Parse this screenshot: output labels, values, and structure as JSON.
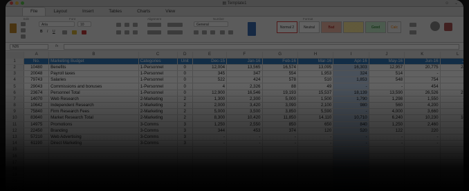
{
  "window": {
    "title": "Template1",
    "right_controls": [
      "☺",
      "⌄"
    ]
  },
  "ribbon": {
    "tabs": [
      "File",
      "Layout",
      "Insert",
      "Tables",
      "Charts",
      "View"
    ],
    "active_tab": "File",
    "font_name": "Aria",
    "font_size": "10",
    "number_format": "General",
    "group_labels": [
      "Edit",
      "Font",
      "Alignment",
      "Number",
      "Format"
    ],
    "styles": [
      "Normal 2",
      "Neutral",
      "Bad",
      "Good",
      "Calc"
    ],
    "colors": {
      "header_blue": "#2f77b8",
      "selected": "#bfd5ef",
      "normal_border": "#d23a3a"
    }
  },
  "formula_bar": {
    "name_box": "N26",
    "fx": "fx",
    "value": ""
  },
  "grid": {
    "columns": [
      "A",
      "B",
      "C",
      "D",
      "E",
      "F",
      "G",
      "H",
      "I",
      "J",
      "K",
      "L"
    ],
    "rows": [
      {
        "n": "1",
        "cells": [
          "No.",
          "Marketing Budget",
          "Categories",
          "Unit",
          "Dec-15",
          "Jan-16",
          "Feb-16",
          "Mar-16",
          "Apr-16",
          "May-16",
          "Jun-16",
          "Jul-16"
        ]
      },
      {
        "n": "2",
        "cells": [
          "10480",
          "Benefits",
          "1-Personnel",
          "0",
          "12,004",
          "13,565",
          "16,574",
          "13,095",
          "16,303",
          "12,957",
          "20,775",
          "24,766"
        ]
      },
      {
        "n": "3",
        "cells": [
          "20048",
          "Payroll taxes",
          "1-Personnel",
          "0",
          "345",
          "347",
          "554",
          "1,953",
          "324",
          "514",
          "-",
          "-"
        ]
      },
      {
        "n": "4",
        "cells": [
          "79743",
          "Salaries",
          "1-Personnel",
          "0",
          "522",
          "424",
          "578",
          "510",
          "1,853",
          "548",
          "754",
          "533"
        ]
      },
      {
        "n": "5",
        "cells": [
          "29043",
          "Commissions and bonuses",
          "1-Personnel",
          "0",
          "4",
          "2,326",
          "88",
          "49",
          "-",
          "-",
          "454",
          "226"
        ]
      },
      {
        "n": "6",
        "cells": [
          "23674",
          "Personnel Total",
          "1-Personnel",
          "0",
          "12,900",
          "16,546",
          "19,193",
          "15,537",
          "18,139",
          "13,590",
          "26,526",
          "25,599"
        ]
      },
      {
        "n": "7",
        "cells": [
          "14070",
          "Web Research",
          "2-Marketing",
          "2",
          "1,300",
          "2,300",
          "5,000",
          "1,500",
          "1,790",
          "1,298",
          "1,550",
          "4,000"
        ]
      },
      {
        "n": "8",
        "cells": [
          "10642",
          "Independent Research",
          "2-Marketing",
          "2",
          "2,000",
          "3,420",
          "3,090",
          "2,100",
          "980",
          "560",
          "4,200",
          "3,870"
        ]
      },
      {
        "n": "9",
        "cells": [
          "75840",
          "Firm Research Fees",
          "2-Marketing",
          "2",
          "5,000",
          "3,500",
          "3,850",
          "5,590",
          "-",
          "4,000",
          "3,660",
          "6,380"
        ]
      },
      {
        "n": "10",
        "cells": [
          "83640",
          "Market Research Total",
          "2-Marketing",
          "2",
          "8,300",
          "10,420",
          "11,850",
          "14,110",
          "10,710",
          "6,240",
          "10,230",
          "10,074"
        ]
      },
      {
        "n": "11",
        "cells": [
          "14975",
          "Promotions",
          "3-Comms",
          "3",
          "1,250",
          "2,550",
          "850",
          "650",
          "840",
          "1,250",
          "2,460",
          "-"
        ]
      },
      {
        "n": "12",
        "cells": [
          "22450",
          "Branding",
          "3-Comms",
          "3",
          "344",
          "453",
          "374",
          "120",
          "520",
          "122",
          "220",
          "-"
        ]
      },
      {
        "n": "13",
        "cells": [
          "57210",
          "Web Advertising",
          "3-Comms",
          "3",
          "-",
          "-",
          "-",
          "-",
          "-",
          "-",
          "-",
          "-"
        ]
      },
      {
        "n": "14",
        "cells": [
          "61190",
          "Direct Marketing",
          "3-Comms",
          "3",
          "-",
          "-",
          "-",
          "-",
          "-",
          "-",
          "-",
          "-"
        ]
      },
      {
        "n": "15",
        "cells": [
          "",
          "",
          "",
          "",
          "",
          "",
          "",
          "",
          "",
          "",
          "",
          ""
        ]
      },
      {
        "n": "16",
        "cells": [
          "",
          "",
          "",
          "",
          "",
          "",
          "",
          "",
          "",
          "",
          "",
          ""
        ]
      },
      {
        "n": "17",
        "cells": [
          "",
          "",
          "",
          "",
          "",
          "",
          "",
          "",
          "",
          "",
          "",
          ""
        ]
      },
      {
        "n": "18",
        "cells": [
          "",
          "",
          "",
          "",
          "",
          "",
          "",
          "",
          "",
          "",
          "",
          ""
        ]
      },
      {
        "n": "19",
        "cells": [
          "",
          "",
          "",
          "",
          "",
          "",
          "",
          "",
          "",
          "",
          "",
          ""
        ]
      },
      {
        "n": "20",
        "cells": [
          "",
          "",
          "",
          "",
          "",
          "",
          "",
          "",
          "",
          "",
          "",
          ""
        ]
      },
      {
        "n": "21",
        "cells": [
          "",
          "",
          "",
          "",
          "",
          "",
          "",
          "",
          "",
          "",
          "",
          ""
        ]
      }
    ],
    "selected_column": "I"
  }
}
